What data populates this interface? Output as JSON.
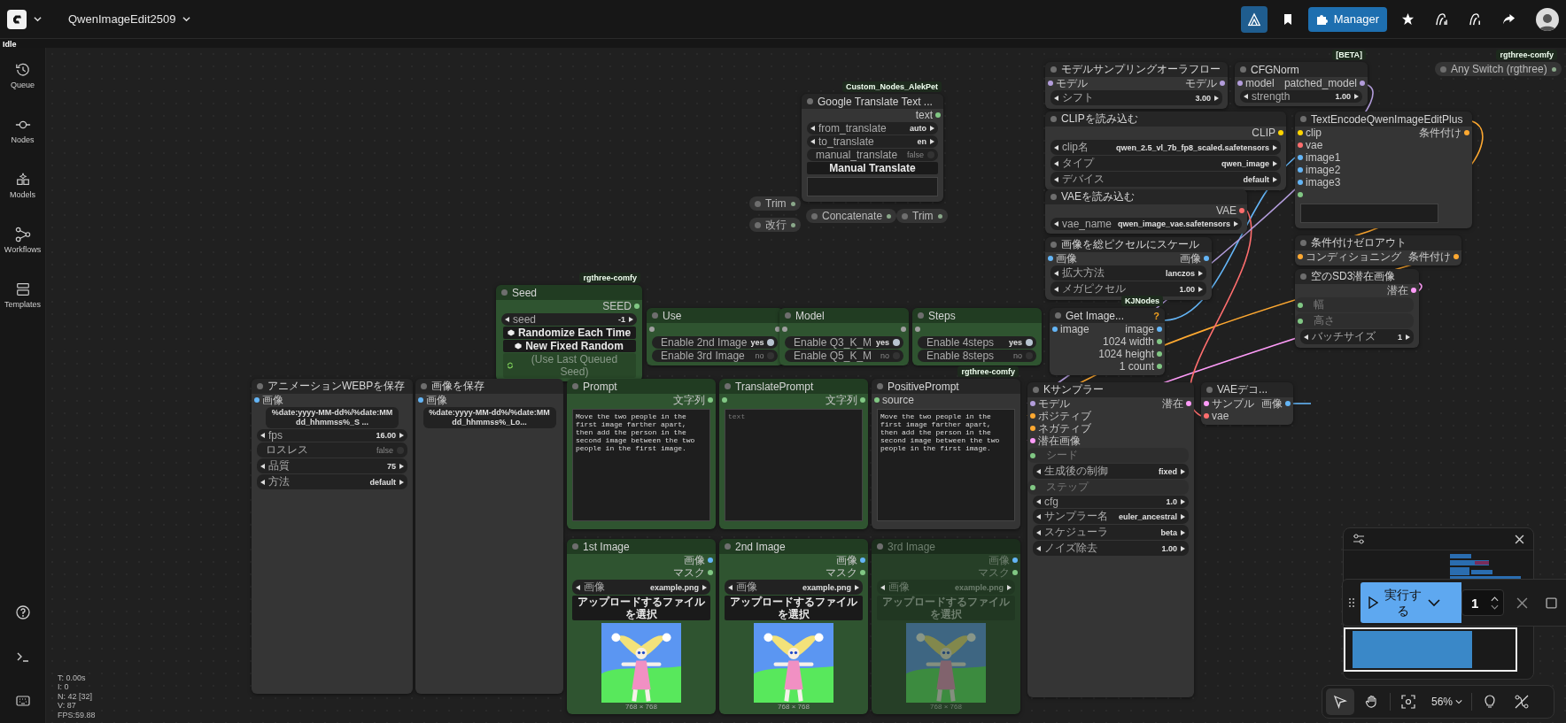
{
  "topbar": {
    "workflow_name": "QwenImageEdit2509",
    "manager_label": "Manager",
    "status": "Idle"
  },
  "sidebar": {
    "items": [
      {
        "label": "Queue"
      },
      {
        "label": "Nodes"
      },
      {
        "label": "Models"
      },
      {
        "label": "Workflows"
      },
      {
        "label": "Templates"
      }
    ]
  },
  "nodes": [
    {
      "title": "Trim",
      "kind": "collapsed",
      "color": "#353535",
      "bypassed": false
    },
    {
      "title": "改行",
      "kind": "collapsed",
      "color": "#353535",
      "bypassed": false
    },
    {
      "title": "Google Translate Text ...",
      "badge": "Custom_Nodes_AlekPet",
      "color": "#353535",
      "bypassed": false,
      "outputs": [
        {
          "label": "text",
          "color": "#81c784"
        }
      ],
      "widgets": [
        {
          "kind": "combo",
          "label": "from_translate",
          "value": "auto"
        },
        {
          "kind": "combo",
          "label": "to_translate",
          "value": "en"
        },
        {
          "kind": "toggle",
          "label": "manual_translate",
          "value": "false",
          "on": false
        },
        {
          "kind": "button",
          "label": "Manual Translate"
        },
        {
          "kind": "textarea"
        }
      ]
    },
    {
      "title": "Concatenate",
      "kind": "collapsed",
      "color": "#353535",
      "bypassed": false
    },
    {
      "title": "Trim",
      "kind": "collapsed",
      "color": "#353535",
      "bypassed": false
    },
    {
      "title": "モデルサンプリングオーラフロー",
      "color": "#353535",
      "bypassed": false,
      "inputs": [
        {
          "label": "モデル",
          "color": "#b39ddb"
        }
      ],
      "outputs": [
        {
          "label": "モデル",
          "color": "#b39ddb"
        }
      ],
      "widgets": [
        {
          "kind": "number",
          "label": "シフト",
          "value": "3.00"
        }
      ]
    },
    {
      "title": "CFGNorm",
      "badge": "[BETA]",
      "color": "#353535",
      "bypassed": false,
      "inputs": [
        {
          "label": "model",
          "color": "#b39ddb"
        }
      ],
      "outputs": [
        {
          "label": "patched_model",
          "color": "#b39ddb"
        }
      ],
      "widgets": [
        {
          "kind": "number",
          "label": "strength",
          "value": "1.00"
        }
      ]
    },
    {
      "title": "Any Switch (rgthree)",
      "kind": "collapsed",
      "badge": "rgthree-comfy",
      "color": "#353535",
      "bypassed": false
    },
    {
      "title": "CLIPを読み込む",
      "color": "#353535",
      "bypassed": false,
      "outputs": [
        {
          "label": "CLIP",
          "color": "#ffd500"
        }
      ],
      "widgets": [
        {
          "kind": "combo",
          "label": "clip名",
          "value": "qwen_2.5_vl_7b_fp8_scaled.safetensors"
        },
        {
          "kind": "combo",
          "label": "タイプ",
          "value": "qwen_image"
        },
        {
          "kind": "combo",
          "label": "デバイス",
          "value": "default"
        }
      ]
    },
    {
      "title": "VAEを読み込む",
      "color": "#353535",
      "bypassed": false,
      "outputs": [
        {
          "label": "VAE",
          "color": "#ff6e6e"
        }
      ],
      "widgets": [
        {
          "kind": "combo",
          "label": "vae_name",
          "value": "qwen_image_vae.safetensors"
        }
      ]
    },
    {
      "title": "TextEncodeQwenImageEditPlus",
      "color": "#353535",
      "bypassed": false,
      "inputs": [
        {
          "label": "clip",
          "color": "#ffd500"
        },
        {
          "label": "vae",
          "color": "#ff6e6e"
        },
        {
          "label": "image1",
          "color": "#64b5f6"
        },
        {
          "label": "image2",
          "color": "#64b5f6"
        },
        {
          "label": "image3",
          "color": "#64b5f6"
        },
        {
          "color": "#81c784"
        }
      ],
      "outputs": [
        {
          "label": "条件付け",
          "color": "#ffa931"
        }
      ],
      "widgets": [
        {
          "kind": "textarea"
        }
      ]
    },
    {
      "title": "Seed",
      "badge": "rgthree-comfy",
      "color": "#2f5430",
      "bypassed": false,
      "outputs": [
        {
          "label": "SEED",
          "color": "#81c784"
        }
      ],
      "widgets": [
        {
          "kind": "number",
          "label": "seed",
          "value": "-1"
        },
        {
          "kind": "dice_button",
          "label": "Randomize Each Time",
          "disabled": false
        },
        {
          "kind": "dice_button",
          "label": "New Fixed Random",
          "disabled": false
        },
        {
          "kind": "recycle_button",
          "label": "(Use Last Queued Seed)",
          "disabled": true
        }
      ]
    },
    {
      "title": "画像を総ピクセルにスケール",
      "color": "#353535",
      "bypassed": false,
      "inputs": [
        {
          "label": "画像",
          "color": "#64b5f6"
        }
      ],
      "outputs": [
        {
          "label": "画像",
          "color": "#64b5f6"
        }
      ],
      "widgets": [
        {
          "kind": "combo",
          "label": "拡大方法",
          "value": "lanczos"
        },
        {
          "kind": "number",
          "label": "メガピクセル",
          "value": "1.00"
        }
      ]
    },
    {
      "title": "条件付けゼロアウト",
      "color": "#353535",
      "bypassed": false,
      "inputs": [
        {
          "label": "コンディショニング",
          "color": "#ffa931"
        }
      ],
      "outputs": [
        {
          "label": "条件付け",
          "color": "#ffa931"
        }
      ]
    },
    {
      "title": "Use",
      "color": "#2f5430",
      "bypassed": false,
      "inputs": [
        {
          "color": "#9e9e9e"
        }
      ],
      "outputs": [
        {
          "color": "#9e9e9e"
        }
      ],
      "widgets": [
        {
          "kind": "toggle",
          "label": "Enable 2nd Image",
          "value": "yes",
          "on": true
        },
        {
          "kind": "toggle",
          "label": "Enable 3rd Image",
          "value": "no",
          "on": false
        }
      ]
    },
    {
      "title": "Model",
      "color": "#2f5430",
      "bypassed": false,
      "inputs": [
        {
          "color": "#9e9e9e"
        }
      ],
      "outputs": [
        {
          "color": "#9e9e9e"
        }
      ],
      "widgets": [
        {
          "kind": "toggle",
          "label": "Enable Q3_K_M",
          "value": "yes",
          "on": true
        },
        {
          "kind": "toggle",
          "label": "Enable Q5_K_M",
          "value": "no",
          "on": false
        }
      ]
    },
    {
      "title": "Steps",
      "color": "#2f5430",
      "bypassed": false,
      "inputs": [
        {
          "color": "#9e9e9e"
        }
      ],
      "widgets": [
        {
          "kind": "toggle",
          "label": "Enable 4steps",
          "value": "yes",
          "on": true
        },
        {
          "kind": "toggle",
          "label": "Enable 8steps",
          "value": "no",
          "on": false
        }
      ]
    },
    {
      "title": "Get Image...",
      "badge": "KJNodes",
      "help": "?",
      "color": "#353535",
      "bypassed": false,
      "inputs": [
        {
          "label": "image",
          "color": "#64b5f6"
        }
      ],
      "outputs": [
        {
          "label": "image",
          "color": "#64b5f6"
        },
        {
          "label": "1024 width",
          "color": "#81c784"
        },
        {
          "label": "1024 height",
          "color": "#81c784"
        },
        {
          "label": "1 count",
          "color": "#81c784"
        }
      ]
    },
    {
      "title": "空のSD3潜在画像",
      "color": "#353535",
      "bypassed": false,
      "outputs": [
        {
          "label": "潜在",
          "color": "#ff9cf9"
        }
      ],
      "widgets": [
        {
          "kind": "converted",
          "label": "幅",
          "color": "#81c784"
        },
        {
          "kind": "converted",
          "label": "高さ",
          "color": "#81c784"
        },
        {
          "kind": "number",
          "label": "バッチサイズ",
          "value": "1"
        }
      ]
    },
    {
      "title": "アニメーションWEBPを保存",
      "color": "#353535",
      "bypassed": false,
      "inputs": [
        {
          "label": "画像",
          "color": "#64b5f6"
        }
      ],
      "widgets": [
        {
          "kind": "text",
          "value": "%date:yyyy-MM-dd%/%date:MMdd_hhmmss%_S ..."
        },
        {
          "kind": "number",
          "label": "fps",
          "value": "16.00"
        },
        {
          "kind": "toggle",
          "label": "ロスレス",
          "value": "false",
          "on": false
        },
        {
          "kind": "number",
          "label": "品質",
          "value": "75"
        },
        {
          "kind": "combo",
          "label": "方法",
          "value": "default"
        }
      ]
    },
    {
      "title": "画像を保存",
      "color": "#353535",
      "bypassed": false,
      "inputs": [
        {
          "label": "画像",
          "color": "#64b5f6"
        }
      ],
      "widgets": [
        {
          "kind": "text",
          "value": "%date:yyyy-MM-dd%/%date:MMdd_hhmmss%_Lo..."
        }
      ]
    },
    {
      "title": "Prompt",
      "color": "#2f5430",
      "bypassed": false,
      "outputs": [
        {
          "label": "文字列",
          "color": "#81c784"
        }
      ],
      "widgets": [
        {
          "kind": "textarea",
          "value": "Move the two people in the first image farther apart, then add the person in the second image between the two people in the first image."
        }
      ]
    },
    {
      "title": "TranslatePrompt",
      "color": "#2f5430",
      "bypassed": false,
      "inputs": [
        {
          "color": "#81c784"
        }
      ],
      "outputs": [
        {
          "label": "文字列",
          "color": "#81c784"
        }
      ],
      "widgets": [
        {
          "kind": "textarea",
          "placeholder": "text"
        }
      ]
    },
    {
      "title": "PositivePrompt",
      "badge": "rgthree-comfy",
      "color": "#353535",
      "bypassed": false,
      "inputs": [
        {
          "label": "source",
          "color": "#81c784"
        }
      ],
      "widgets": [
        {
          "kind": "textarea",
          "value": "Move the two people in the first image farther apart, then add the person in the second image between the two people in the first image."
        }
      ]
    },
    {
      "title": "1st Image",
      "color": "#2f5430",
      "bypassed": false,
      "outputs": [
        {
          "label": "画像",
          "color": "#64b5f6"
        },
        {
          "label": "マスク",
          "color": "#81c784"
        }
      ],
      "widgets": [
        {
          "kind": "combo",
          "label": "画像",
          "value": "example.png"
        },
        {
          "kind": "button",
          "label": "アップロードするファイルを選択"
        },
        {
          "kind": "image",
          "caption": "768 × 768"
        }
      ]
    },
    {
      "title": "2nd Image",
      "color": "#2f5430",
      "bypassed": false,
      "outputs": [
        {
          "label": "画像",
          "color": "#64b5f6"
        },
        {
          "label": "マスク",
          "color": "#81c784"
        }
      ],
      "widgets": [
        {
          "kind": "combo",
          "label": "画像",
          "value": "example.png"
        },
        {
          "kind": "button",
          "label": "アップロードするファイルを選択"
        },
        {
          "kind": "image",
          "caption": "768 × 768"
        }
      ]
    },
    {
      "title": "3rd Image",
      "color": "#263f27",
      "bypassed": true,
      "outputs": [
        {
          "label": "画像",
          "color": "#64b5f6"
        },
        {
          "label": "マスク",
          "color": "#81c784"
        }
      ],
      "widgets": [
        {
          "kind": "combo",
          "label": "画像",
          "value": "example.png"
        },
        {
          "kind": "button",
          "label": "アップロードするファイルを選択"
        },
        {
          "kind": "image",
          "caption": "768 × 768"
        }
      ]
    },
    {
      "title": "Kサンプラー",
      "color": "#353535",
      "bypassed": false,
      "inputs": [
        {
          "label": "モデル",
          "color": "#b39ddb"
        },
        {
          "label": "ポジティブ",
          "color": "#ffa931"
        },
        {
          "label": "ネガティブ",
          "color": "#ffa931"
        },
        {
          "label": "潜在画像",
          "color": "#ff9cf9"
        }
      ],
      "outputs": [
        {
          "label": "潜在",
          "color": "#ff9cf9"
        }
      ],
      "widgets": [
        {
          "kind": "converted",
          "label": "シード",
          "color": "#81c784"
        },
        {
          "kind": "combo",
          "label": "生成後の制御",
          "value": "fixed"
        },
        {
          "kind": "converted",
          "label": "ステップ",
          "color": "#81c784"
        },
        {
          "kind": "number",
          "label": "cfg",
          "value": "1.0"
        },
        {
          "kind": "combo",
          "label": "サンプラー名",
          "value": "euler_ancestral"
        },
        {
          "kind": "combo",
          "label": "スケジューラ",
          "value": "beta"
        },
        {
          "kind": "number",
          "label": "ノイズ除去",
          "value": "1.00"
        }
      ]
    },
    {
      "title": "VAEデコ...",
      "color": "#353535",
      "bypassed": false,
      "inputs": [
        {
          "label": "サンプル",
          "color": "#ff9cf9"
        },
        {
          "label": "vae",
          "color": "#ff6e6e"
        }
      ],
      "outputs": [
        {
          "label": "画像",
          "color": "#64b5f6"
        }
      ]
    }
  ],
  "stats": [
    "T: 0.00s",
    "I: 0",
    "N: 42 [32]",
    "V: 87",
    "FPS:59.88"
  ],
  "run_bar": {
    "run_label": "実行する",
    "count": "1"
  },
  "canvas_toolbar": {
    "tools": [
      {
        "kind": "select",
        "selected": true
      },
      {
        "kind": "hand",
        "selected": false
      }
    ],
    "zoom": "56%"
  }
}
